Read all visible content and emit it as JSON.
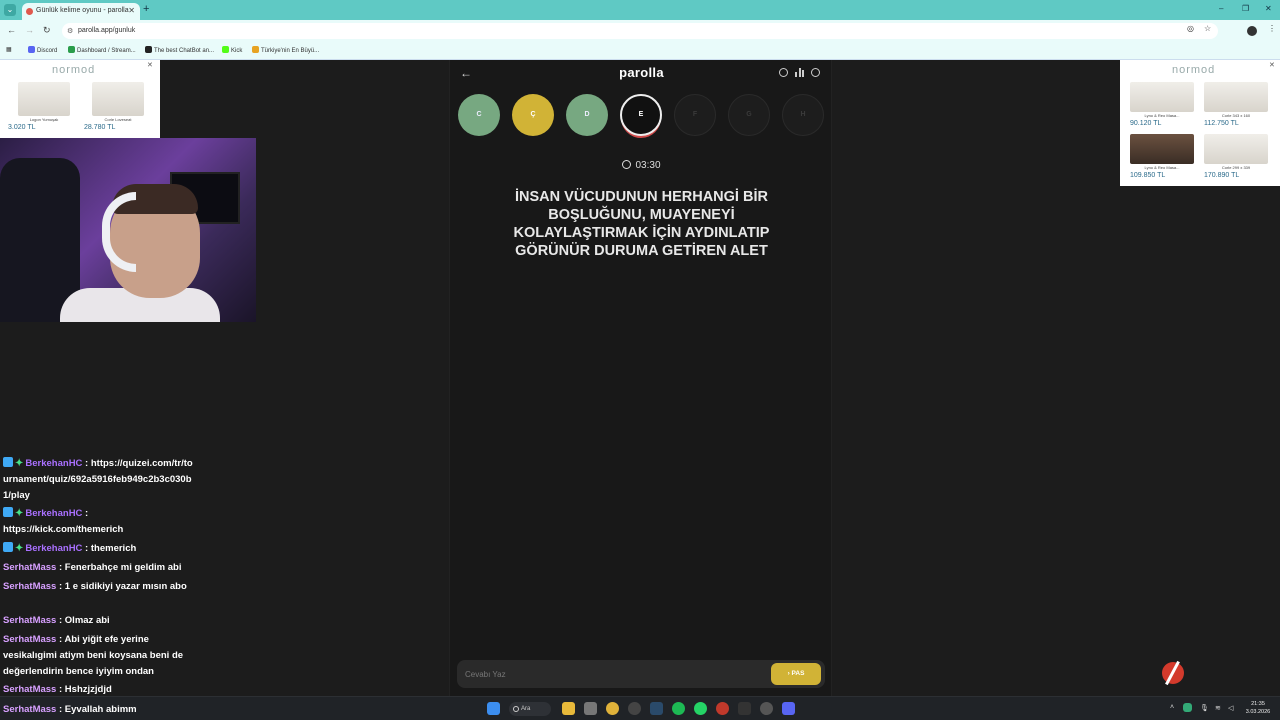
{
  "browser": {
    "tab_title": "Günlük kelime oyunu - parolla",
    "url": "parolla.app/gunluk",
    "bookmarks": [
      "Discord",
      "Dashboard / Stream...",
      "The best ChatBot an...",
      "Kick",
      "Türkiye'nin En Büyü..."
    ]
  },
  "ads": {
    "left": {
      "brand": "normod",
      "products": [
        {
          "caption": "Logon Yumuşak",
          "price": "3.020 TL"
        },
        {
          "caption": "Corle Loveseat",
          "price": "28.780 TL"
        }
      ]
    },
    "right": {
      "brand": "normod",
      "products": [
        {
          "caption": "Lyno & Reo Masa...",
          "price": "90.120 TL"
        },
        {
          "caption": "Corle 343 x 160",
          "price": "112.750 TL"
        },
        {
          "caption": "Lyno & Reo Masa...",
          "price": "109.850 TL"
        },
        {
          "caption": "Corle 299 x 339",
          "price": "170.890 TL"
        }
      ]
    }
  },
  "game": {
    "logo": "parolla",
    "letters": [
      {
        "letter": "C",
        "state": "correct"
      },
      {
        "letter": "Ç",
        "state": "passed"
      },
      {
        "letter": "D",
        "state": "correct"
      },
      {
        "letter": "E",
        "state": "active"
      },
      {
        "letter": "F",
        "state": "pending"
      },
      {
        "letter": "G",
        "state": "pending"
      },
      {
        "letter": "H",
        "state": "pending"
      }
    ],
    "timer": "03:30",
    "question": "İNSAN VÜCUDUNUN HERHANGİ BİR BOŞLUĞUNU, MUAYENEYİ KOLAYLAŞTIRMAK İÇİN AYDINLATIP GÖRÜNÜR DURUMA GETİREN ALET",
    "answer_placeholder": "Cevabı Yaz",
    "pass_label": "PAS",
    "colors": {
      "correct": "#77a881",
      "passed": "#d1b336",
      "active_ring": "#d04a4a"
    }
  },
  "chat": [
    {
      "user": "BerkehanHC",
      "badges": true,
      "text": "https://quizei.com/tr/tournament/quiz/692a5916feb949c2b3c030b1/play"
    },
    {
      "user": "BerkehanHC",
      "badges": true,
      "text": "https://kick.com/themerich"
    },
    {
      "user": "BerkehanHC",
      "badges": true,
      "text": "themerich"
    },
    {
      "user": "SerhatMass",
      "badges": false,
      "text": "Fenerbahçe mi geldim abi"
    },
    {
      "user": "SerhatMass",
      "badges": false,
      "text": "1 e sidikiyi yazar mısın abo"
    },
    {
      "user": "SerhatMass",
      "badges": false,
      "text": "Olmaz abi"
    },
    {
      "user": "SerhatMass",
      "badges": false,
      "text": "Abi yiğit efe yerine vesikalıgimi atiym beni koysana beni de değerlendirin bence iyiyim ondan"
    },
    {
      "user": "SerhatMass",
      "badges": false,
      "text": "Hshzjzjdjd"
    },
    {
      "user": "SerhatMass",
      "badges": false,
      "text": "Eyvallah abimm"
    }
  ],
  "taskbar": {
    "search_label": "Ara",
    "time": "21:35",
    "date": "3.03.2026"
  }
}
